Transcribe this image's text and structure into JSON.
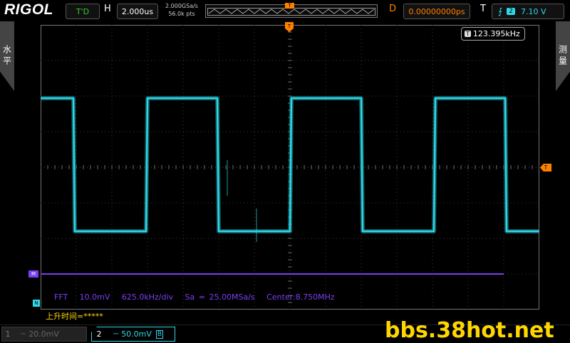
{
  "header": {
    "logo": "RIGOL",
    "run_state": "T'D",
    "h_label": "H",
    "timebase": "2.000us",
    "sample_rate": "2.000GSa/s",
    "memory_depth": "56.0k pts",
    "mem_trigger_marker": "T",
    "d_label": "D",
    "delay": "0.00000000ps",
    "t_label": "T",
    "trigger_edge_icon": "rising-edge-icon",
    "trigger_source": "2",
    "trigger_level": "7.10 V"
  },
  "side_tabs": {
    "left": "水平",
    "right": "测量"
  },
  "measurement": {
    "icon_text": "T",
    "frequency": "123.395kHz"
  },
  "markers": {
    "trigger_position": "T",
    "trigger_level": "T",
    "math_marker": "M",
    "channel_marker": "N"
  },
  "math": {
    "fft_info": "FFT   10.0mV   625.0kHz/div   Sa = 25.00MSa/s   Center:8.750MHz"
  },
  "measure_readout": "上升时间=*****",
  "channels": [
    {
      "number": "1",
      "coupling": "⎓",
      "scale": "20.0mV",
      "active": false
    },
    {
      "number": "2",
      "coupling": "⎓",
      "scale": "50.0mV",
      "bw": "B",
      "active": true
    }
  ],
  "watermark": "bbs.38hot.net",
  "waveform": {
    "channel": "2",
    "shape": "triangle",
    "periods_visible": 3.5,
    "color": "#2ed8e8",
    "math_color": "#7a3ff0",
    "trigger_color": "#ff8000"
  }
}
